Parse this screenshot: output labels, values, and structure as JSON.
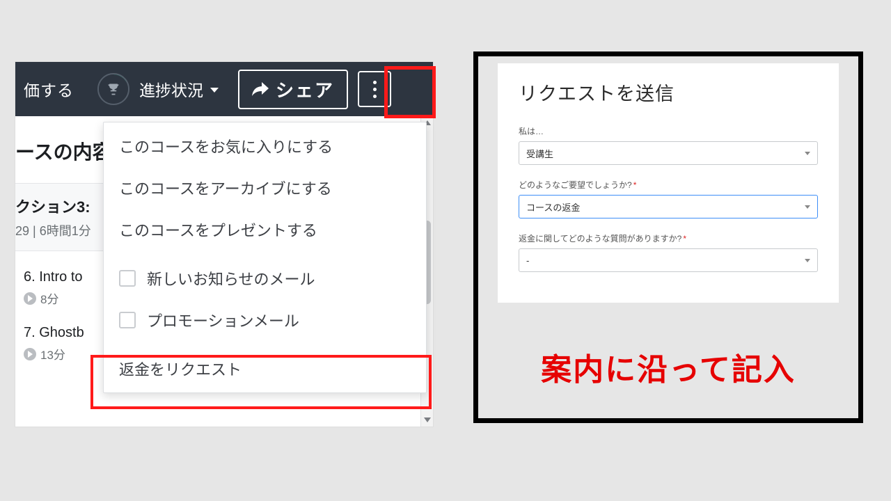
{
  "left": {
    "header": {
      "rate": "価する",
      "progress": "進捗状況",
      "share": "シェア"
    },
    "content_title": "ースの内容",
    "section": {
      "title": "クション3:",
      "meta": "29 | 6時間1分"
    },
    "lessons": [
      {
        "title": "6. Intro to",
        "duration": "8分"
      },
      {
        "title": "7. Ghostb",
        "duration": "13分"
      }
    ],
    "menu": {
      "favorite": "このコースをお気に入りにする",
      "archive": "このコースをアーカイブにする",
      "gift": "このコースをプレゼントする",
      "mail_news": "新しいお知らせのメール",
      "mail_promo": "プロモーションメール",
      "refund": "返金をリクエスト"
    }
  },
  "right": {
    "form": {
      "title": "リクエストを送信",
      "field1_label": "私は…",
      "field1_value": "受講生",
      "field2_label": "どのようなご要望でしょうか?",
      "field2_value": "コースの返金",
      "field3_label": "返金に関してどのような質問がありますか?",
      "field3_value": "-"
    },
    "instruction": "案内に沿って記入"
  }
}
